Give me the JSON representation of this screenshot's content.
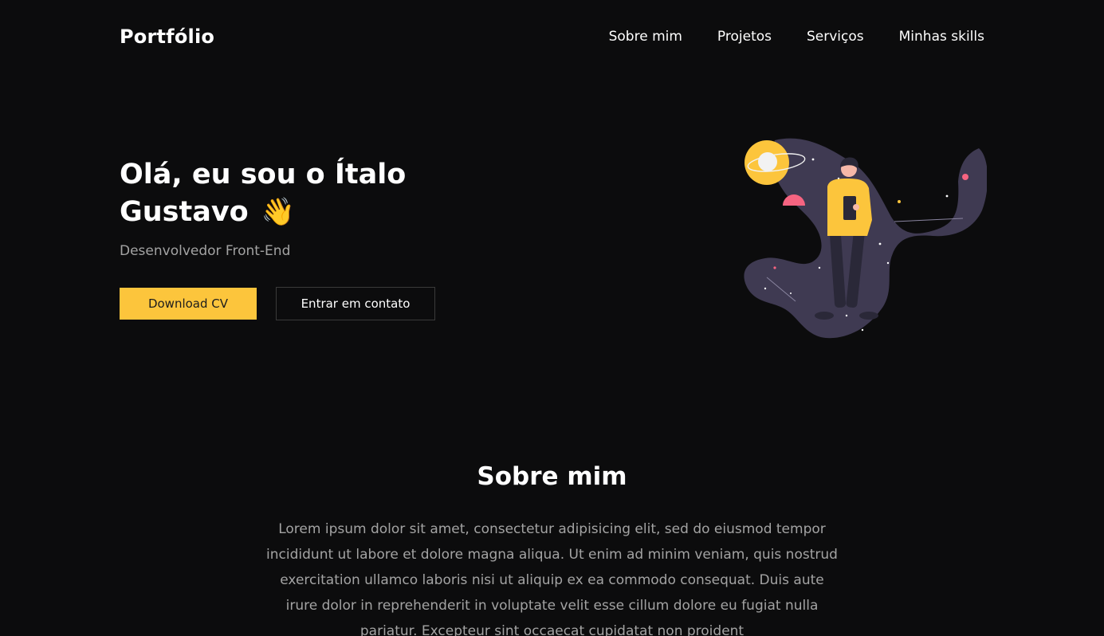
{
  "header": {
    "logo": "Portfólio",
    "nav": [
      "Sobre mim",
      "Projetos",
      "Serviços",
      "Minhas skills"
    ]
  },
  "hero": {
    "title": "Olá, eu sou o Ítalo Gustavo",
    "wave": "👋",
    "subtitle": "Desenvolvedor Front-End",
    "download_label": "Download CV",
    "contact_label": "Entrar em contato"
  },
  "about": {
    "title": "Sobre mim",
    "text": "Lorem ipsum dolor sit amet, consectetur adipisicing elit, sed do eiusmod tempor incididunt ut labore et dolore magna aliqua. Ut enim ad minim veniam, quis nostrud exercitation ullamco laboris nisi ut aliquip ex ea commodo consequat. Duis aute irure dolor in reprehenderit in voluptate velit esse cillum dolore eu fugiat nulla pariatur. Excepteur sint occaecat cupidatat non proident"
  },
  "colors": {
    "background": "#0c0c0d",
    "accent": "#fcc53c",
    "muted_text": "#a3a3a3",
    "planet_pink": "#f66481",
    "space_purple": "#3f3a52"
  },
  "icons": [
    "waving-hand-icon",
    "astronaut-illustration"
  ]
}
